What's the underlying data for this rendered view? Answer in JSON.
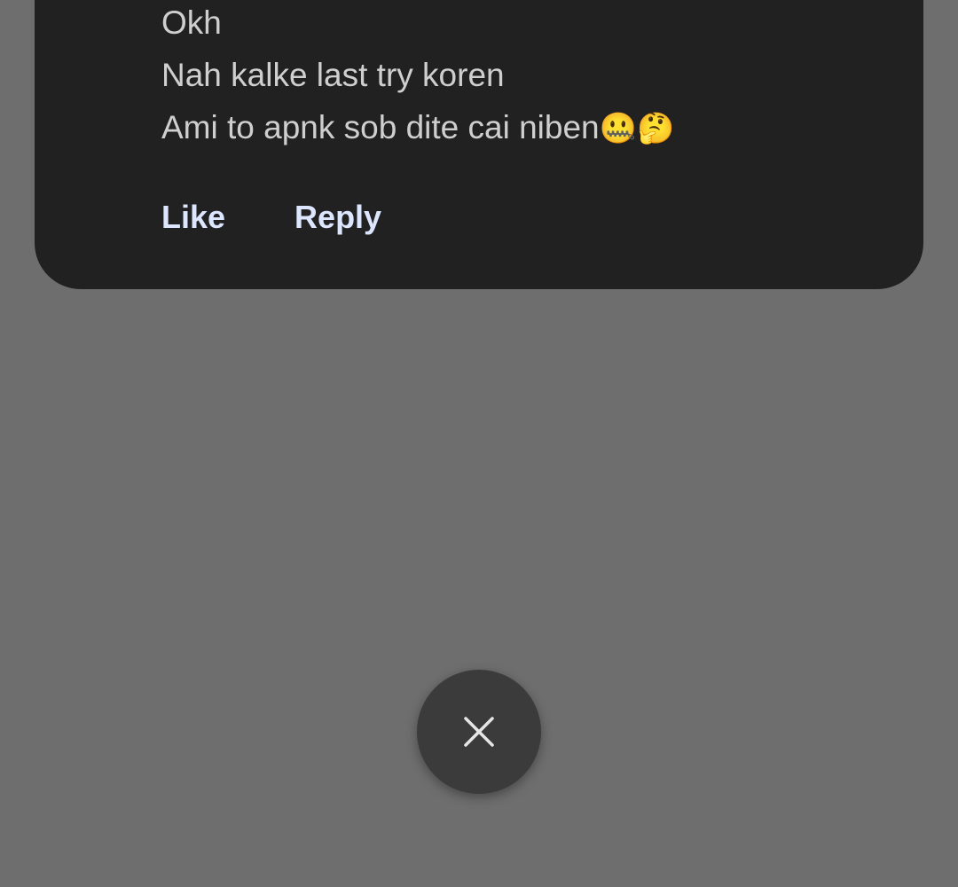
{
  "message": {
    "lines": [
      {
        "text": "Okh",
        "emojis": ""
      },
      {
        "text": "Nah kalke last try koren",
        "emojis": ""
      },
      {
        "text": "Ami to apnk sob dite cai niben",
        "emojis": "🤐🤔"
      }
    ]
  },
  "actions": {
    "like_label": "Like",
    "reply_label": "Reply"
  },
  "close_button": {
    "icon": "close-icon"
  },
  "colors": {
    "background_overlay": "#6e6e6e",
    "card": "#212121",
    "message_text": "#cfcfcf",
    "action_text": "#dde6ff",
    "close_button": "#3b3b3b"
  }
}
